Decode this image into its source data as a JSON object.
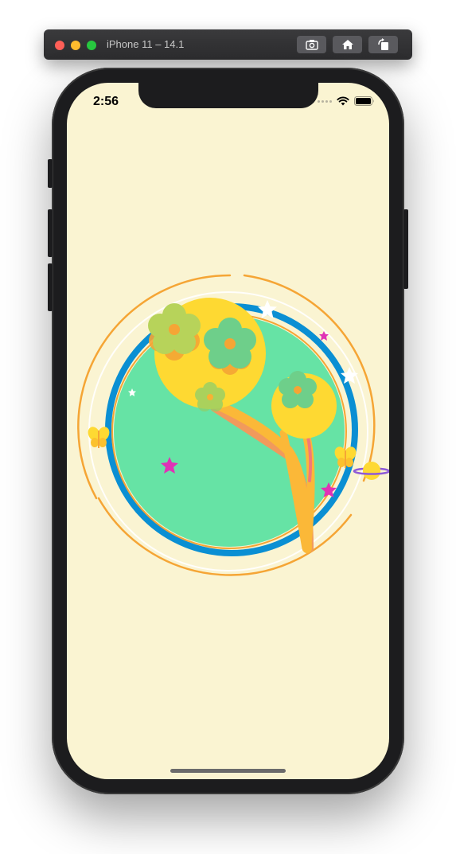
{
  "simulator": {
    "title": "iPhone 11 – 14.1",
    "buttons": {
      "screenshot": "camera-icon",
      "home": "home-icon",
      "rotate": "rotate-icon"
    }
  },
  "status_bar": {
    "time": "2:56",
    "icons": [
      "signal-dots-icon",
      "wifi-icon",
      "battery-icon"
    ]
  },
  "app": {
    "background_color": "#faf4d2",
    "illustration": {
      "elements": [
        "orange-ring",
        "white-ring",
        "blue-ring",
        "green-disc",
        "yellow-tree-large",
        "yellow-tree-small",
        "flowers",
        "stars",
        "butterflies",
        "planet"
      ]
    }
  },
  "colors": {
    "green": "#66e3a5",
    "blue": "#0a8fd3",
    "orange": "#f5a535",
    "yellow": "#fed932",
    "magenta": "#e032b6",
    "flower_green": "#6ecf8a",
    "flower_lime": "#b7d35a"
  }
}
